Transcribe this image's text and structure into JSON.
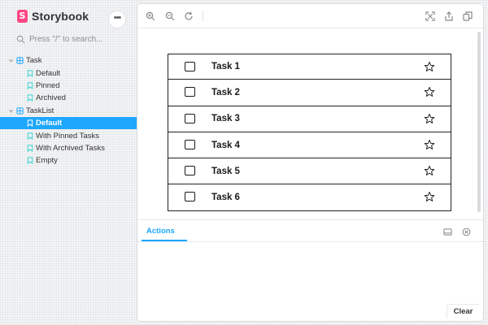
{
  "app": {
    "name": "Storybook",
    "menu_icon": "ellipsis-icon",
    "accent": "#1ea7fd",
    "brand_color": "#ff4785"
  },
  "search": {
    "placeholder": "Press \"/\" to search..."
  },
  "sidebar": {
    "groups": [
      {
        "label": "Task",
        "stories": [
          "Default",
          "Pinned",
          "Archived"
        ]
      },
      {
        "label": "TaskList",
        "stories": [
          "Default",
          "With Pinned Tasks",
          "With Archived Tasks",
          "Empty"
        ]
      }
    ],
    "selected": {
      "group": "TaskList",
      "story": "Default"
    }
  },
  "toolbar": {
    "left_icons": [
      "zoom-in-icon",
      "zoom-out-icon",
      "reset-zoom-icon"
    ],
    "right_icons": [
      "fullscreen-icon",
      "share-icon",
      "copy-icon"
    ]
  },
  "tasks": [
    {
      "title": "Task 1",
      "checked": false,
      "pinned": false
    },
    {
      "title": "Task 2",
      "checked": false,
      "pinned": false
    },
    {
      "title": "Task 3",
      "checked": false,
      "pinned": false
    },
    {
      "title": "Task 4",
      "checked": false,
      "pinned": false
    },
    {
      "title": "Task 5",
      "checked": false,
      "pinned": false
    },
    {
      "title": "Task 6",
      "checked": false,
      "pinned": false
    }
  ],
  "addons": {
    "tab": "Actions",
    "icons": [
      "panel-position-icon",
      "close-panel-icon"
    ],
    "clear_label": "Clear"
  }
}
